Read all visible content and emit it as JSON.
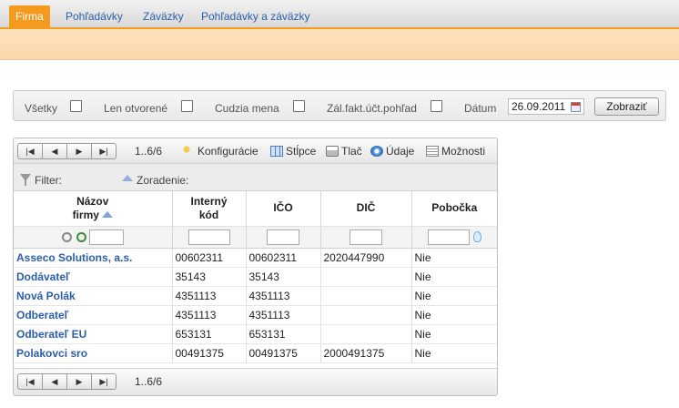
{
  "tabs": [
    {
      "label": "Firma",
      "active": true
    },
    {
      "label": "Pohľadávky",
      "active": false
    },
    {
      "label": "Záväzky",
      "active": false
    },
    {
      "label": "Pohľadávky a záväzky",
      "active": false
    }
  ],
  "filter_panel": {
    "vsetky_label": "Všetky",
    "len_otvorene_label": "Len otvorené",
    "cudzia_mena_label": "Cudzia mena",
    "zal_fakt_label": "Zál.fakt.účt.pohľad",
    "datum_label": "Dátum",
    "datum_value": "26.09.2011",
    "zobrazit_label": "Zobraziť"
  },
  "grid": {
    "pager_info": "1..6/6",
    "toolbar": {
      "konfiguracie": "Konfigurácie",
      "stlpce": "Stĺpce",
      "tlac": "Tlač",
      "udaje": "Údaje",
      "moznosti": "Možnosti"
    },
    "filter_label": "Filter:",
    "zoradenie_label": "Zoradenie:",
    "columns": {
      "nazov_line1": "Názov",
      "nazov_line2": "firmy",
      "interny_line1": "Interný",
      "interny_line2": "kód",
      "ico": "IČO",
      "dic": "DIČ",
      "pobocka": "Pobočka"
    },
    "rows": [
      {
        "name": "Asseco Solutions, a.s.",
        "interny": "00602311",
        "ico": "00602311",
        "dic": "2020447990",
        "pobocka": "Nie"
      },
      {
        "name": "Dodávateľ",
        "interny": "35143",
        "ico": "35143",
        "dic": "",
        "pobocka": "Nie"
      },
      {
        "name": "Nová Polák",
        "interny": "4351113",
        "ico": "4351113",
        "dic": "",
        "pobocka": "Nie"
      },
      {
        "name": "Odberateľ",
        "interny": "4351113",
        "ico": "4351113",
        "dic": "",
        "pobocka": "Nie"
      },
      {
        "name": "Odberateľ EU",
        "interny": "653131",
        "ico": "653131",
        "dic": "",
        "pobocka": "Nie"
      },
      {
        "name": "Polakovci sro",
        "interny": "00491375",
        "ico": "00491375",
        "dic": "2000491375",
        "pobocka": "Nie"
      }
    ]
  },
  "colors": {
    "accent": "#f39a1f",
    "link": "#2b5ea8"
  }
}
